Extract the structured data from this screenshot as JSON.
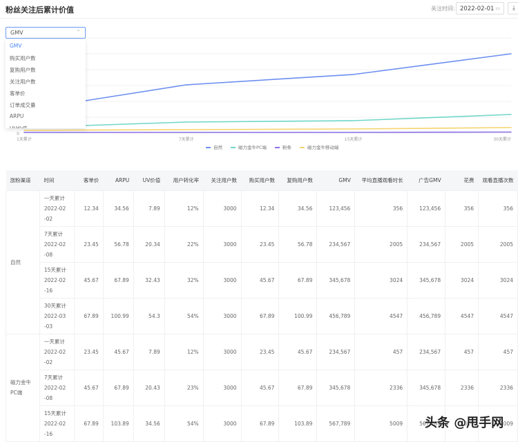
{
  "header": {
    "title": "粉丝关注后累计价值",
    "date_label": "关注时间:",
    "date_value": "2022-02-01",
    "calendar_icon": "calendar-icon",
    "download_icon": "download-icon"
  },
  "metric_select": {
    "value": "GMV",
    "options": [
      "GMV",
      "购买用户数",
      "复购用户数",
      "关注用户数",
      "客单价",
      "订单成交量",
      "ARPU",
      "UV价值"
    ]
  },
  "chart_data": {
    "type": "line",
    "categories": [
      "1天累计",
      "7天累计",
      "15天累计",
      "30天累计"
    ],
    "y_tick_labels": [
      "0"
    ],
    "ylim": [
      0,
      140
    ],
    "grid": true,
    "legend_position": "bottom",
    "series": [
      {
        "name": "自然",
        "color": "#6b8ef0",
        "values": [
          33,
          70,
          85,
          115
        ]
      },
      {
        "name": "磁力金牛PC端",
        "color": "#6fd6c8",
        "values": [
          8,
          16,
          18,
          27
        ]
      },
      {
        "name": "粉条",
        "color": "#8a6fe8",
        "values": [
          1,
          1,
          1,
          1.5
        ]
      },
      {
        "name": "磁力金牛移动端",
        "color": "#f5d36b",
        "values": [
          4,
          5,
          6,
          8
        ]
      }
    ]
  },
  "table": {
    "columns": [
      "涨粉渠道",
      "时间",
      "客单价",
      "ARPU",
      "UV价值",
      "用户转化率",
      "关注用户数",
      "购买用户数",
      "复购用户数",
      "GMV",
      "平均直播观看时长",
      "广告GMV",
      "花费",
      "观看直播次数"
    ],
    "groups": [
      {
        "channel": "自然",
        "rows": [
          {
            "period": "一天累计",
            "date": "2022-02-02",
            "cells": [
              "12.34",
              "34.56",
              "7.89",
              "12%",
              "3000",
              "12.34",
              "34.56",
              "123,456",
              "356",
              "123,456",
              "356",
              "356"
            ]
          },
          {
            "period": "7天累计",
            "date": "2022-02-08",
            "cells": [
              "23.45",
              "56.78",
              "20.34",
              "22%",
              "3000",
              "23.45",
              "56.78",
              "234,567",
              "2005",
              "234,567",
              "2005",
              "2005"
            ]
          },
          {
            "period": "15天累计",
            "date": "2022-02-16",
            "cells": [
              "45.67",
              "67.89",
              "32.43",
              "32%",
              "3000",
              "45.67",
              "67.89",
              "345,678",
              "3024",
              "345,678",
              "3024",
              "3024"
            ]
          },
          {
            "period": "30天累计",
            "date": "2022-03-03",
            "cells": [
              "67.89",
              "100.99",
              "54.3",
              "54%",
              "3000",
              "67.89",
              "100.99",
              "456,789",
              "4547",
              "456,789",
              "4547",
              "4547"
            ]
          }
        ]
      },
      {
        "channel": "磁力金牛PC端",
        "rows": [
          {
            "period": "一天累计",
            "date": "2022-02-02",
            "cells": [
              "23.45",
              "45.67",
              "7.89",
              "12%",
              "3000",
              "23.45",
              "45.67",
              "234,567",
              "457",
              "234,567",
              "457",
              "457"
            ]
          },
          {
            "period": "7天累计",
            "date": "2022-02-08",
            "cells": [
              "45.67",
              "67.89",
              "20.43",
              "23%",
              "3000",
              "45.67",
              "67.89",
              "345,678",
              "2336",
              "345,678",
              "2336",
              "2336"
            ]
          },
          {
            "period": "15天累计",
            "date": "2022-02-16",
            "cells": [
              "67.89",
              "103.89",
              "34.56",
              "54%",
              "3000",
              "67.89",
              "103.89",
              "567,789",
              "5009",
              "567,789",
              "5009",
              "5009"
            ]
          }
        ]
      }
    ]
  },
  "watermark": "头条 @甩手网"
}
